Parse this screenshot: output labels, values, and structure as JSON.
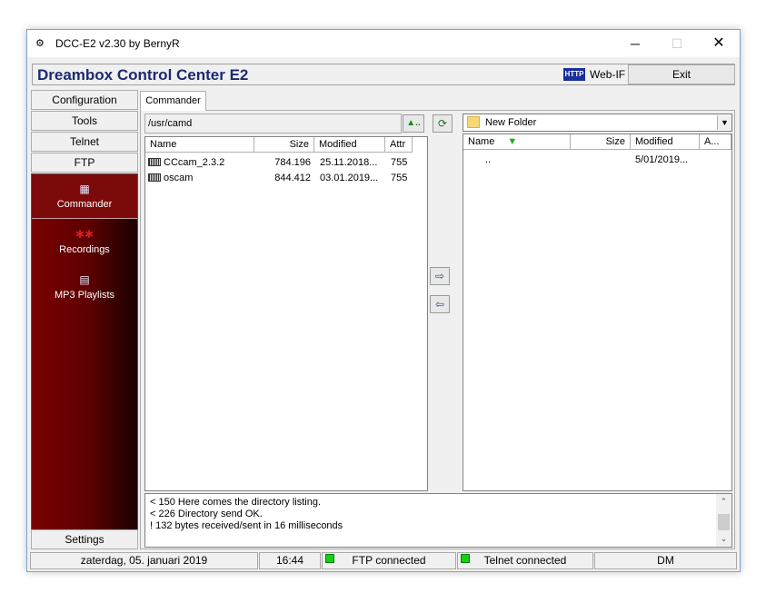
{
  "window": {
    "title": "DCC-E2 v2.30 by BernyR",
    "minimize": "─",
    "maximize": "☐",
    "close": "✕"
  },
  "header": {
    "app_name": "Dreambox Control Center E2",
    "http_badge": "HTTP",
    "webif_label": "Web-IF",
    "exit_label": "Exit"
  },
  "sidebar": {
    "buttons": [
      "Configuration",
      "Tools",
      "Telnet",
      "FTP"
    ],
    "panel_items": [
      {
        "label": "Commander",
        "icon": "grid-icon",
        "glyph": "▦"
      },
      {
        "label": "Recordings",
        "icon": "recordings-icon",
        "glyph": "✱✱"
      },
      {
        "label": "MP3 Playlists",
        "icon": "playlist-icon",
        "glyph": "▤"
      }
    ],
    "settings_label": "Settings"
  },
  "tabs": {
    "active": "Commander"
  },
  "left_pane": {
    "path": "/usr/camd",
    "up_glyph": "▲..",
    "refresh_glyph": "⟳",
    "columns": [
      "Name",
      "Size",
      "Modified",
      "Attr"
    ],
    "rows": [
      {
        "name": "CCcam_2.3.2",
        "size": "784.196",
        "modified": "25.11.2018...",
        "attr": "755"
      },
      {
        "name": "oscam",
        "size": "844.412",
        "modified": "03.01.2019...",
        "attr": "755"
      }
    ]
  },
  "transfer": {
    "copy_right_glyph": "⇨",
    "copy_left_glyph": "⇦"
  },
  "right_pane": {
    "drive": "New Folder",
    "dropdown_glyph": "▼",
    "columns": [
      "Name",
      "Size",
      "Modified",
      "A..."
    ],
    "sort_glyph": "▼",
    "rows": [
      {
        "name": "..",
        "modified": "5/01/2019..."
      }
    ]
  },
  "log": {
    "lines": [
      "< 150 Here comes the directory listing.",
      "< 226 Directory send OK.",
      "! 132 bytes received/sent in 16 milliseconds"
    ],
    "scroll_up": "⌃",
    "scroll_down": "⌄"
  },
  "status": {
    "date": "zaterdag, 05. januari 2019",
    "time": "16:44",
    "ftp": "FTP connected",
    "telnet": "Telnet connected",
    "model": "DM"
  },
  "colors": {
    "led": "#13d213",
    "sidebar_red": "#7a0000",
    "heading": "#1c2a6e"
  }
}
